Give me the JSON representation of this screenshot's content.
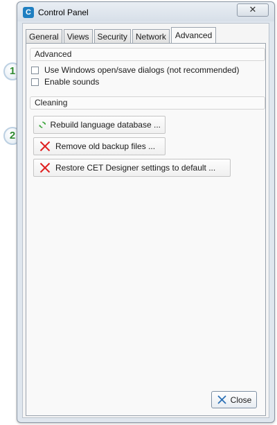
{
  "window": {
    "title": "Control Panel",
    "close_glyph": "✕"
  },
  "tabs": [
    {
      "label": "General",
      "active": false
    },
    {
      "label": "Views",
      "active": false
    },
    {
      "label": "Security",
      "active": false
    },
    {
      "label": "Network",
      "active": false
    },
    {
      "label": "Advanced",
      "active": true
    }
  ],
  "advanced": {
    "header": "Advanced",
    "options": [
      {
        "label": "Use Windows open/save dialogs (not recommended)",
        "checked": false
      },
      {
        "label": "Enable sounds",
        "checked": false
      }
    ]
  },
  "cleaning": {
    "header": "Cleaning",
    "actions": [
      {
        "label": "Rebuild language database ...",
        "icon": "refresh-icon"
      },
      {
        "label": "Remove old backup files ...",
        "icon": "red-x-icon"
      },
      {
        "label": "Restore CET Designer settings to default ...",
        "icon": "red-x-icon"
      }
    ]
  },
  "footer": {
    "close_label": "Close",
    "close_icon": "close-x-icon"
  },
  "callouts": [
    "1",
    "2"
  ],
  "colors": {
    "callout_number": "#2f8a2f",
    "refresh_green": "#3aa53a",
    "remove_red": "#e02020",
    "close_blue": "#2a6fb5"
  }
}
